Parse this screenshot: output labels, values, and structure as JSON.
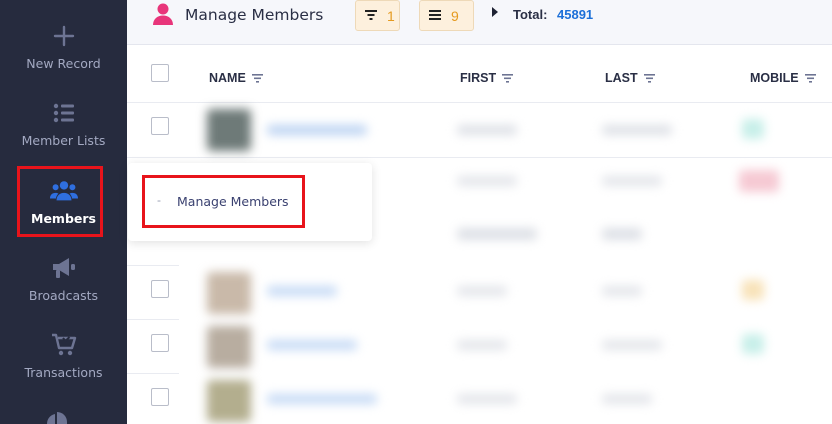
{
  "sidebar": {
    "items": [
      {
        "label": "New Record",
        "icon": "plus-icon",
        "active": false
      },
      {
        "label": "Member Lists",
        "icon": "list-icon",
        "active": false
      },
      {
        "label": "Members",
        "icon": "users-icon",
        "active": true
      },
      {
        "label": "Broadcasts",
        "icon": "megaphone-icon",
        "active": false
      },
      {
        "label": "Transactions",
        "icon": "cart-icon",
        "active": false
      }
    ]
  },
  "header": {
    "title": "Manage Members",
    "filter_count": "1",
    "list_count": "9",
    "total_label": "Total:",
    "total_value": "45891"
  },
  "table": {
    "columns": [
      "NAME",
      "FIRST",
      "LAST",
      "MOBILE"
    ]
  },
  "dropdown": {
    "bullet": "-",
    "item_label": "Manage Members"
  },
  "colors": {
    "sidebar_bg": "#262b3e",
    "accent_blue": "#2f6fe0",
    "accent_pink": "#e8357a",
    "highlight_red": "#e8141b",
    "pill_bg": "#fdf0dd",
    "total_blue": "#1b6fd8"
  }
}
